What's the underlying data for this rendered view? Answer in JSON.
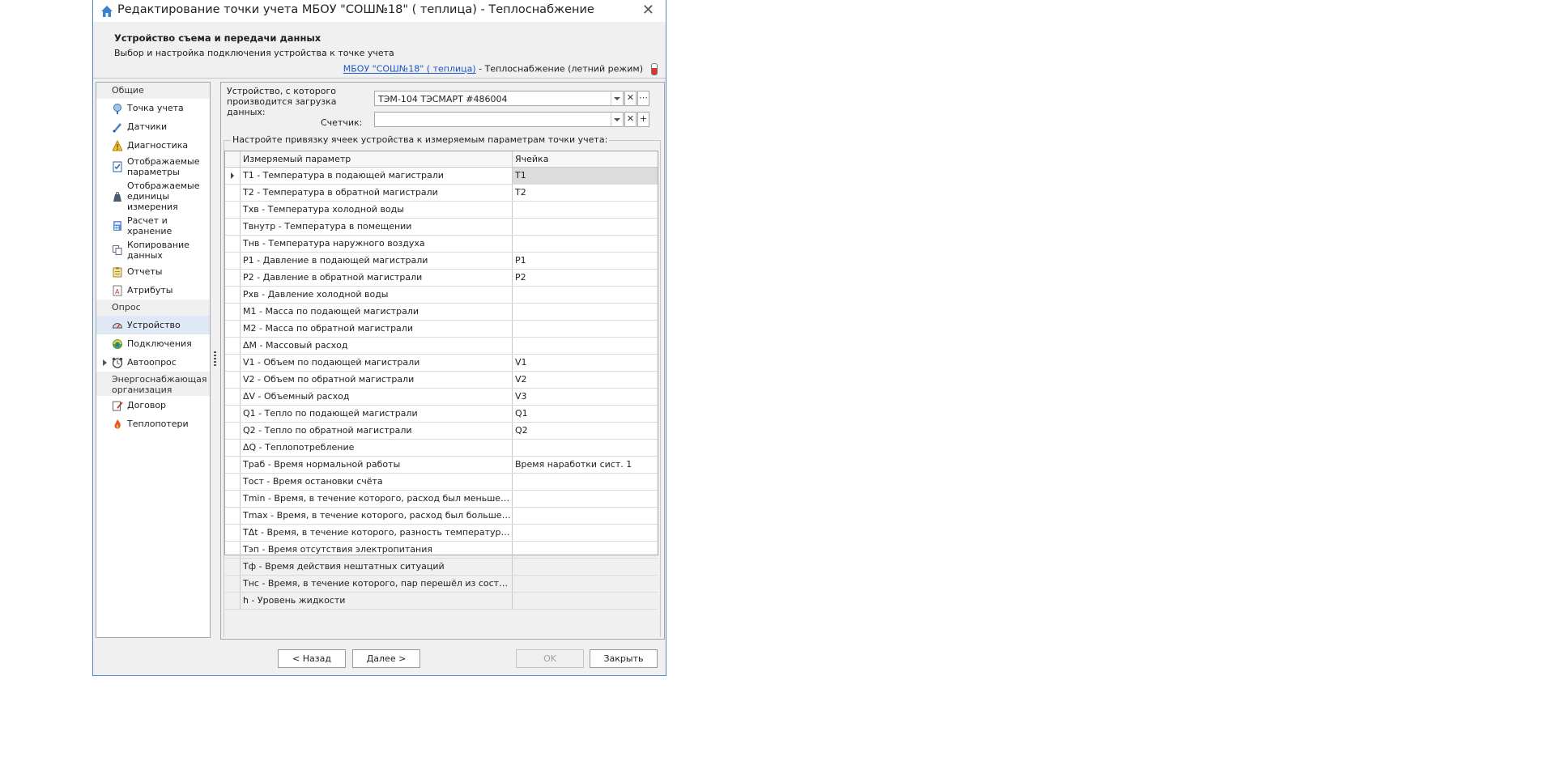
{
  "window": {
    "title": "Редактирование точки учета МБОУ \"СОШ№18\" ( теплица) - Теплоснабжение",
    "header_title": "Устройство съема и передачи данных",
    "header_subtitle": "Выбор и настройка подключения устройства к точке учета",
    "header_link": "МБОУ \"СОШ№18\" ( теплица)",
    "header_link_suffix": " - Теплоснабжение (летний режим)"
  },
  "nav": {
    "group_general": "Общие",
    "items_general": [
      {
        "label": "Точка учета"
      },
      {
        "label": "Датчики"
      },
      {
        "label": "Диагностика"
      },
      {
        "label": "Отображаемые параметры"
      },
      {
        "label": "Отображаемые единицы измерения"
      },
      {
        "label": "Расчет и хранение"
      },
      {
        "label": "Копирование данных"
      },
      {
        "label": "Отчеты"
      },
      {
        "label": "Атрибуты"
      }
    ],
    "group_poll": "Опрос",
    "items_poll": [
      {
        "label": "Устройство"
      },
      {
        "label": "Подключения"
      },
      {
        "label": "Автоопрос"
      }
    ],
    "group_energy": "Энергоснабжающая организация",
    "items_energy": [
      {
        "label": "Договор"
      },
      {
        "label": "Теплопотери"
      }
    ]
  },
  "form": {
    "device_label": "Устройство, с которого производится загрузка данных:",
    "device_value": "ТЭМ-104 ТЭСМАРТ #486004",
    "counter_label": "Счетчик:",
    "counter_value": "",
    "clear_glyph": "✕",
    "more_glyph": "⋯",
    "add_glyph": "+",
    "group_legend": "Настройте привязку ячеек устройства к измеряемым параметрам точки учета:"
  },
  "grid": {
    "col_param": "Измеряемый параметр",
    "col_cell": "Ячейка",
    "rows": [
      {
        "param": "T1 - Температура в подающей магистрали",
        "cell": "T1"
      },
      {
        "param": "T2 - Температура в обратной магистрали",
        "cell": "T2"
      },
      {
        "param": "Tхв - Температура холодной воды",
        "cell": ""
      },
      {
        "param": "Tвнутр - Температура в помещении",
        "cell": ""
      },
      {
        "param": "Tнв - Температура наружного воздуха",
        "cell": ""
      },
      {
        "param": "P1 - Давление в подающей магистрали",
        "cell": "P1"
      },
      {
        "param": "P2 - Давление в обратной магистрали",
        "cell": "P2"
      },
      {
        "param": "Pхв - Давление холодной воды",
        "cell": ""
      },
      {
        "param": "M1 - Масса по подающей магистрали",
        "cell": ""
      },
      {
        "param": "M2 - Масса по обратной магистрали",
        "cell": ""
      },
      {
        "param": "ΔM - Массовый расход",
        "cell": ""
      },
      {
        "param": "V1 - Объем по подающей магистрали",
        "cell": "V1"
      },
      {
        "param": "V2 - Объем по обратной магистрали",
        "cell": "V2"
      },
      {
        "param": "ΔV - Объемный расход",
        "cell": "V3"
      },
      {
        "param": "Q1 - Тепло по подающей магистрали",
        "cell": "Q1"
      },
      {
        "param": "Q2 - Тепло по обратной магистрали",
        "cell": "Q2"
      },
      {
        "param": "ΔQ - Теплопотребление",
        "cell": ""
      },
      {
        "param": "Tраб - Время нормальной работы",
        "cell": "Время наработки сист. 1"
      },
      {
        "param": "Tост - Время остановки счёта",
        "cell": ""
      },
      {
        "param": "Tmin - Время, в течение которого, расход был меньше минимума",
        "cell": ""
      },
      {
        "param": "Tmax - Время, в течение которого, расход был больше максим...",
        "cell": ""
      },
      {
        "param": "TΔt - Время, в течение которого, разность температур была ...",
        "cell": ""
      },
      {
        "param": "Tэп - Время отсутствия электропитания",
        "cell": ""
      },
      {
        "param": "Tф - Время действия нештатных ситуаций",
        "cell": ""
      },
      {
        "param": "Tнс - Время, в течение которого, пар перешёл из состояния п...",
        "cell": ""
      },
      {
        "param": "h - Уровень жидкости",
        "cell": ""
      }
    ]
  },
  "footer": {
    "back": "< Назад",
    "next": "Далее >",
    "ok": "OK",
    "close": "Закрыть"
  },
  "colors": {
    "window_border": "#4a8fd4",
    "link": "#1a55c8",
    "selected_nav": "#dfe8f5"
  }
}
